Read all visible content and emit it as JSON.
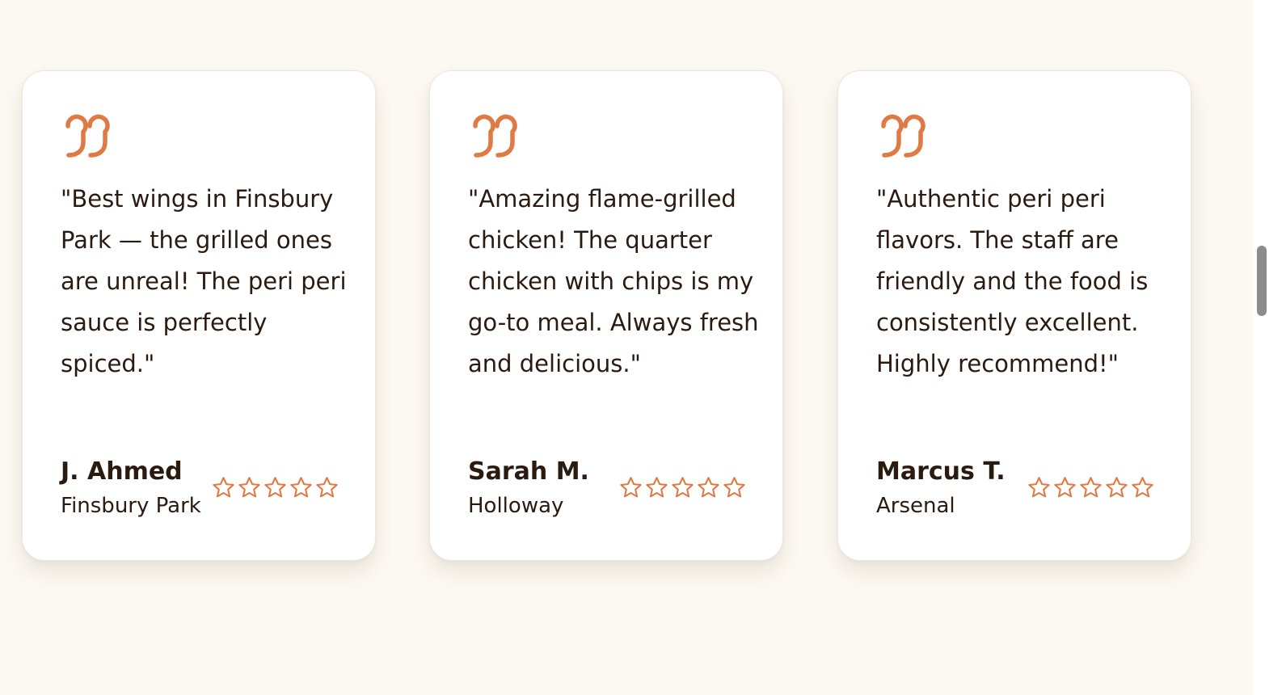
{
  "colors": {
    "accent": "#e07a45",
    "text": "#2a1a10",
    "background": "#fcf9f2",
    "card": "#ffffff"
  },
  "icons": {
    "quote": "quote-icon",
    "rating": "star-outline-icon"
  },
  "testimonials": [
    {
      "quote": "\"Best wings in Finsbury Park — the grilled ones are unreal! The peri peri sauce is perfectly spiced.\"",
      "name": "J. Ahmed",
      "location": "Finsbury Park",
      "rating": 5
    },
    {
      "quote": "\"Amazing flame-grilled chicken! The quarter chicken with chips is my go-to meal. Always fresh and delicious.\"",
      "name": "Sarah M.",
      "location": "Holloway",
      "rating": 5
    },
    {
      "quote": "\"Authentic peri peri flavors. The staff are friendly and the food is consistently excellent. Highly recommend!\"",
      "name": "Marcus T.",
      "location": "Arsenal",
      "rating": 5
    }
  ]
}
